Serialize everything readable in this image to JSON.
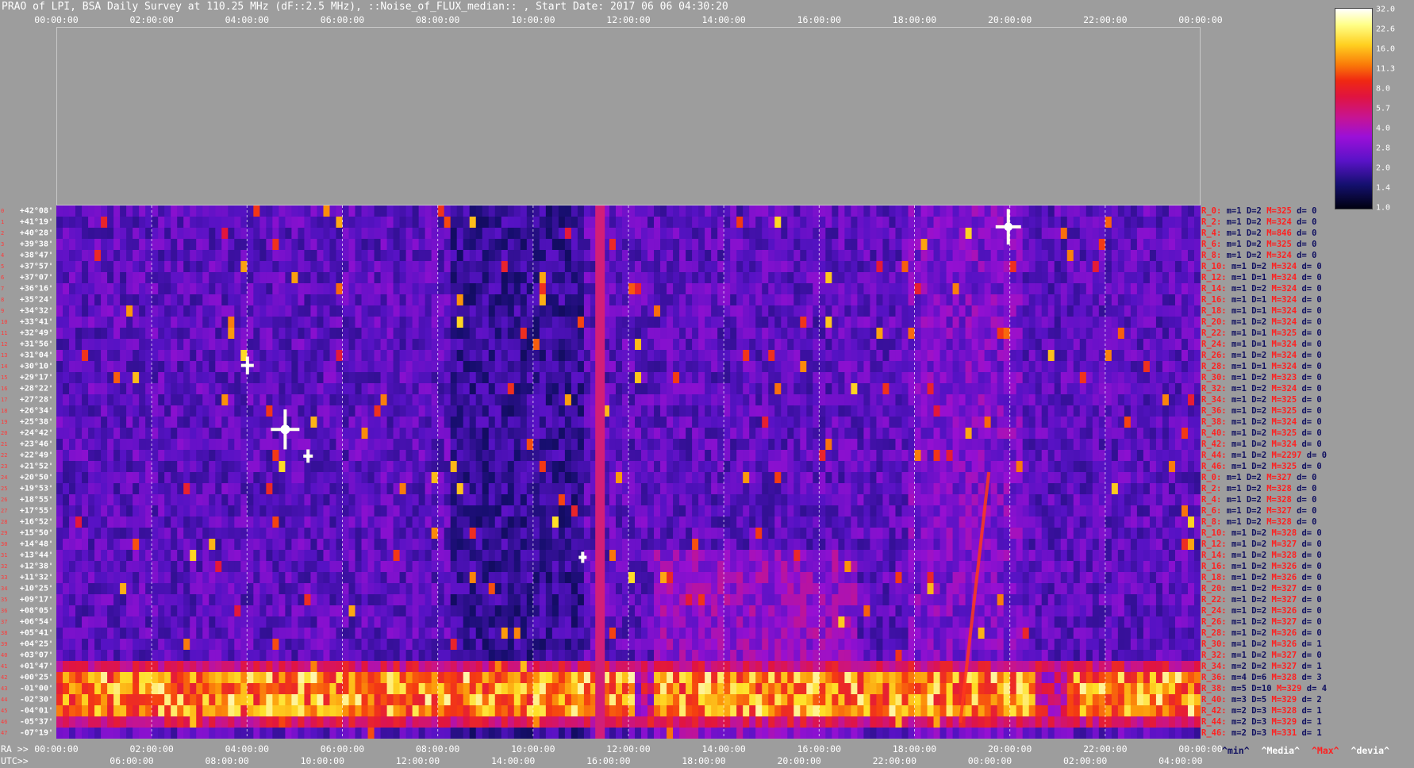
{
  "title": "PRAO of LPI, BSA Daily Survey at 110.25 MHz (dF::2.5 MHz), ::Noise_of_FLUX_median:: , Start Date: 2017 06 06 04:30:20",
  "top_axis_ticks": [
    "00:00:00",
    "02:00:00",
    "04:00:00",
    "06:00:00",
    "08:00:00",
    "10:00:00",
    "12:00:00",
    "14:00:00",
    "16:00:00",
    "18:00:00",
    "20:00:00",
    "22:00:00",
    "00:00:00"
  ],
  "ra_prefix": "RA >>",
  "ra_axis_ticks": [
    "00:00:00",
    "02:00:00",
    "04:00:00",
    "06:00:00",
    "08:00:00",
    "10:00:00",
    "12:00:00",
    "14:00:00",
    "16:00:00",
    "18:00:00",
    "20:00:00",
    "22:00:00",
    "00:00:00"
  ],
  "utc_prefix": "UTC>>",
  "utc_axis_ticks": [
    "06:00:00",
    "08:00:00",
    "10:00:00",
    "12:00:00",
    "14:00:00",
    "16:00:00",
    "18:00:00",
    "20:00:00",
    "22:00:00",
    "00:00:00",
    "02:00:00",
    "04:00:00"
  ],
  "colorbar": {
    "ticks": [
      "32.0",
      "22.6",
      "16.0",
      "11.3",
      "8.0",
      "5.7",
      "4.0",
      "2.8",
      "2.0",
      "1.4",
      "1.0"
    ]
  },
  "legend": {
    "min": "^min^",
    "median": "^Media^",
    "max": "^Max^",
    "dev": "^devia^",
    "min_color": "#101060",
    "max_color": "#ff2020"
  },
  "chart_data": {
    "type": "heatmap",
    "x_axis": "RA (hh:mm:ss)",
    "x_range": [
      "00:00:00",
      "00:00:00"
    ],
    "y_axis": "Declination",
    "colorscale_range": [
      1.0,
      32.0
    ],
    "declinations": [
      "+42°08'",
      "+41°19'",
      "+40°28'",
      "+39°38'",
      "+38°47'",
      "+37°57'",
      "+37°07'",
      "+36°16'",
      "+35°24'",
      "+34°32'",
      "+33°41'",
      "+32°49'",
      "+31°56'",
      "+31°04'",
      "+30°10'",
      "+29°17'",
      "+28°22'",
      "+27°28'",
      "+26°34'",
      "+25°38'",
      "+24°42'",
      "+23°46'",
      "+22°49'",
      "+21°52'",
      "+20°50'",
      "+19°53'",
      "+18°55'",
      "+17°55'",
      "+16°52'",
      "+15°50'",
      "+14°48'",
      "+13°44'",
      "+12°38'",
      "+11°32'",
      "+10°25'",
      "+09°17'",
      "+08°05'",
      "+06°54'",
      "+05°41'",
      "+04°25'",
      "+03°07'",
      "+01°47'",
      "+00°25'",
      "-01°00'",
      "-02°30'",
      "-04°01'",
      "-05°37'",
      "-07°19'"
    ],
    "row_stats": [
      {
        "r": "R_0:",
        "m": "m=1",
        "dv": "D=2",
        "mx": "M=325",
        "d": "d= 0"
      },
      {
        "r": "R_2:",
        "m": "m=1",
        "dv": "D=2",
        "mx": "M=324",
        "d": "d= 0"
      },
      {
        "r": "R_4:",
        "m": "m=1",
        "dv": "D=2",
        "mx": "M=846",
        "d": "d= 0"
      },
      {
        "r": "R_6:",
        "m": "m=1",
        "dv": "D=2",
        "mx": "M=325",
        "d": "d= 0"
      },
      {
        "r": "R_8:",
        "m": "m=1",
        "dv": "D=2",
        "mx": "M=324",
        "d": "d= 0"
      },
      {
        "r": "R_10:",
        "m": "m=1",
        "dv": "D=2",
        "mx": "M=324",
        "d": "d= 0"
      },
      {
        "r": "R_12:",
        "m": "m=1",
        "dv": "D=1",
        "mx": "M=324",
        "d": "d= 0"
      },
      {
        "r": "R_14:",
        "m": "m=1",
        "dv": "D=2",
        "mx": "M=324",
        "d": "d= 0"
      },
      {
        "r": "R_16:",
        "m": "m=1",
        "dv": "D=1",
        "mx": "M=324",
        "d": "d= 0"
      },
      {
        "r": "R_18:",
        "m": "m=1",
        "dv": "D=1",
        "mx": "M=324",
        "d": "d= 0"
      },
      {
        "r": "R_20:",
        "m": "m=1",
        "dv": "D=2",
        "mx": "M=324",
        "d": "d= 0"
      },
      {
        "r": "R_22:",
        "m": "m=1",
        "dv": "D=1",
        "mx": "M=325",
        "d": "d= 0"
      },
      {
        "r": "R_24:",
        "m": "m=1",
        "dv": "D=1",
        "mx": "M=324",
        "d": "d= 0"
      },
      {
        "r": "R_26:",
        "m": "m=1",
        "dv": "D=2",
        "mx": "M=324",
        "d": "d= 0"
      },
      {
        "r": "R_28:",
        "m": "m=1",
        "dv": "D=1",
        "mx": "M=324",
        "d": "d= 0"
      },
      {
        "r": "R_30:",
        "m": "m=1",
        "dv": "D=2",
        "mx": "M=323",
        "d": "d= 0"
      },
      {
        "r": "R_32:",
        "m": "m=1",
        "dv": "D=2",
        "mx": "M=324",
        "d": "d= 0"
      },
      {
        "r": "R_34:",
        "m": "m=1",
        "dv": "D=2",
        "mx": "M=325",
        "d": "d= 0"
      },
      {
        "r": "R_36:",
        "m": "m=1",
        "dv": "D=2",
        "mx": "M=325",
        "d": "d= 0"
      },
      {
        "r": "R_38:",
        "m": "m=1",
        "dv": "D=2",
        "mx": "M=324",
        "d": "d= 0"
      },
      {
        "r": "R_40:",
        "m": "m=1",
        "dv": "D=2",
        "mx": "M=325",
        "d": "d= 0"
      },
      {
        "r": "R_42:",
        "m": "m=1",
        "dv": "D=2",
        "mx": "M=324",
        "d": "d= 0"
      },
      {
        "r": "R_44:",
        "m": "m=1",
        "dv": "D=2",
        "mx": "M=2297",
        "d": "d= 0"
      },
      {
        "r": "R_46:",
        "m": "m=1",
        "dv": "D=2",
        "mx": "M=325",
        "d": "d= 0"
      },
      {
        "r": "R_0:",
        "m": "m=1",
        "dv": "D=2",
        "mx": "M=327",
        "d": "d= 0"
      },
      {
        "r": "R_2:",
        "m": "m=1",
        "dv": "D=2",
        "mx": "M=328",
        "d": "d= 0"
      },
      {
        "r": "R_4:",
        "m": "m=1",
        "dv": "D=2",
        "mx": "M=328",
        "d": "d= 0"
      },
      {
        "r": "R_6:",
        "m": "m=1",
        "dv": "D=2",
        "mx": "M=327",
        "d": "d= 0"
      },
      {
        "r": "R_8:",
        "m": "m=1",
        "dv": "D=2",
        "mx": "M=328",
        "d": "d= 0"
      },
      {
        "r": "R_10:",
        "m": "m=1",
        "dv": "D=2",
        "mx": "M=328",
        "d": "d= 0"
      },
      {
        "r": "R_12:",
        "m": "m=1",
        "dv": "D=2",
        "mx": "M=327",
        "d": "d= 0"
      },
      {
        "r": "R_14:",
        "m": "m=1",
        "dv": "D=2",
        "mx": "M=328",
        "d": "d= 0"
      },
      {
        "r": "R_16:",
        "m": "m=1",
        "dv": "D=2",
        "mx": "M=326",
        "d": "d= 0"
      },
      {
        "r": "R_18:",
        "m": "m=1",
        "dv": "D=2",
        "mx": "M=326",
        "d": "d= 0"
      },
      {
        "r": "R_20:",
        "m": "m=1",
        "dv": "D=2",
        "mx": "M=327",
        "d": "d= 0"
      },
      {
        "r": "R_22:",
        "m": "m=1",
        "dv": "D=2",
        "mx": "M=327",
        "d": "d= 0"
      },
      {
        "r": "R_24:",
        "m": "m=1",
        "dv": "D=2",
        "mx": "M=326",
        "d": "d= 0"
      },
      {
        "r": "R_26:",
        "m": "m=1",
        "dv": "D=2",
        "mx": "M=327",
        "d": "d= 0"
      },
      {
        "r": "R_28:",
        "m": "m=1",
        "dv": "D=2",
        "mx": "M=326",
        "d": "d= 0"
      },
      {
        "r": "R_30:",
        "m": "m=1",
        "dv": "D=2",
        "mx": "M=326",
        "d": "d= 1"
      },
      {
        "r": "R_32:",
        "m": "m=1",
        "dv": "D=2",
        "mx": "M=327",
        "d": "d= 0"
      },
      {
        "r": "R_34:",
        "m": "m=2",
        "dv": "D=2",
        "mx": "M=327",
        "d": "d= 1"
      },
      {
        "r": "R_36:",
        "m": "m=4",
        "dv": "D=6",
        "mx": "M=328",
        "d": "d= 3"
      },
      {
        "r": "R_38:",
        "m": "m=5",
        "dv": "D=10",
        "mx": "M=329",
        "d": "d= 4"
      },
      {
        "r": "R_40:",
        "m": "m=3",
        "dv": "D=5",
        "mx": "M=329",
        "d": "d= 2"
      },
      {
        "r": "R_42:",
        "m": "m=2",
        "dv": "D=3",
        "mx": "M=328",
        "d": "d= 1"
      },
      {
        "r": "R_44:",
        "m": "m=2",
        "dv": "D=3",
        "mx": "M=329",
        "d": "d= 1"
      },
      {
        "r": "R_46:",
        "m": "m=2",
        "dv": "D=3",
        "mx": "M=331",
        "d": "d= 1"
      }
    ]
  }
}
